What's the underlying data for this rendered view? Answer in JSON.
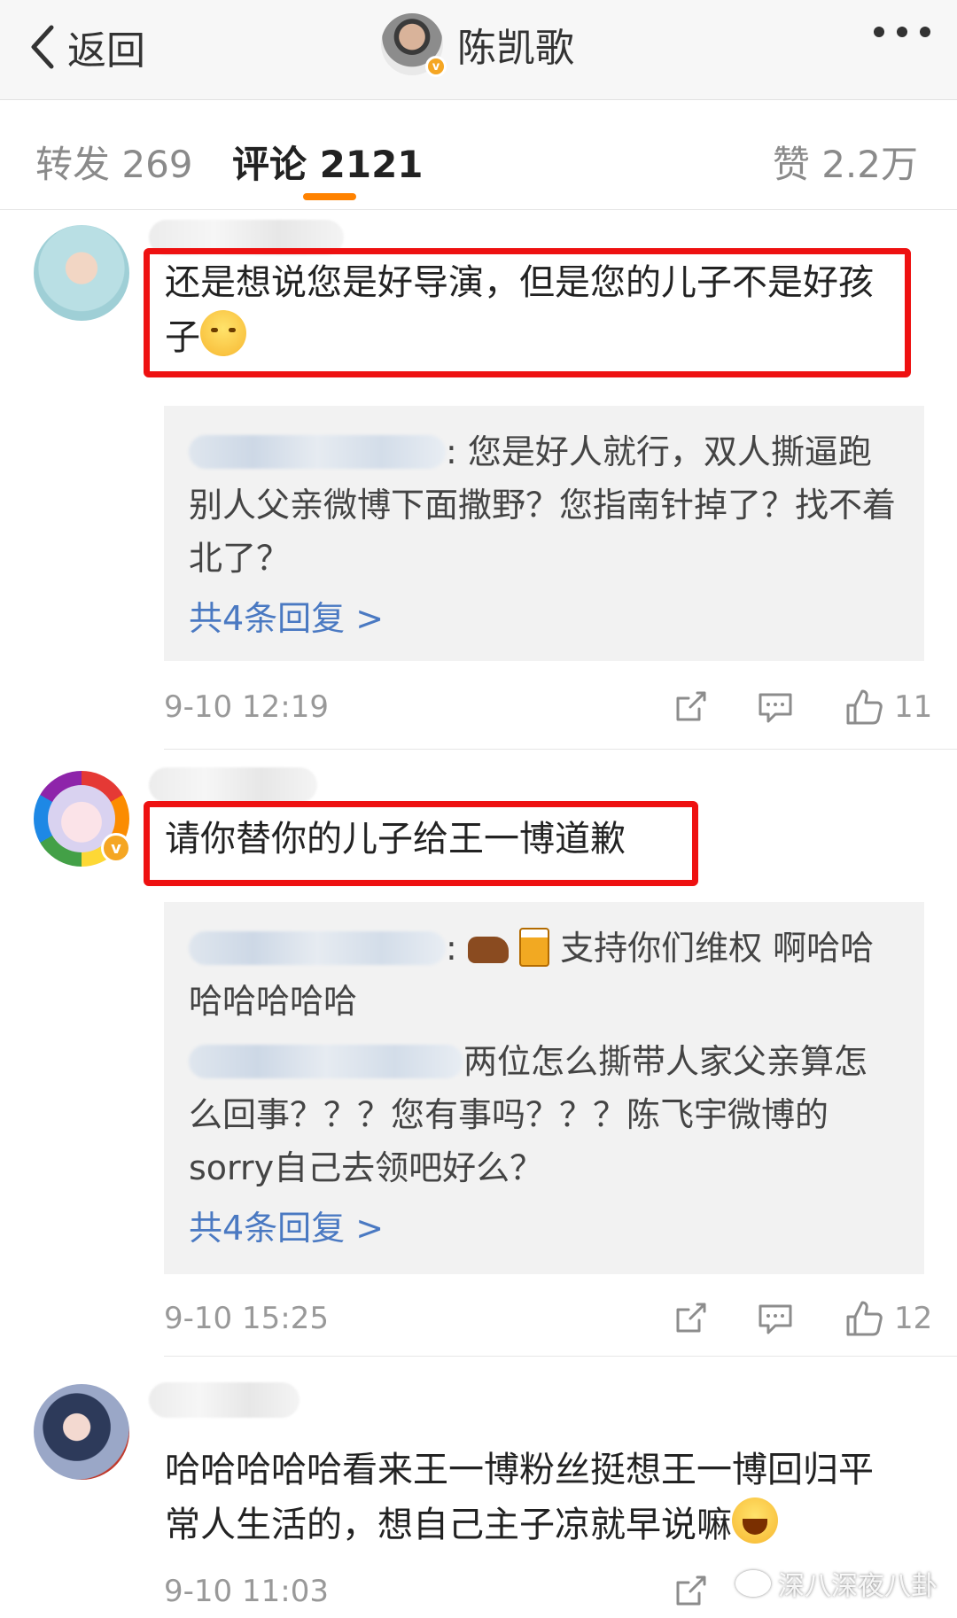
{
  "header": {
    "back_label": "返回",
    "title": "陈凯歌",
    "verified_mark": "v"
  },
  "tabs": {
    "repost": "转发 269",
    "comments": "评论 2121",
    "likes": "赞 2.2万"
  },
  "comments": [
    {
      "text": "还是想说您是好导演，但是您的儿子不是好孩子",
      "highlighted": true,
      "replies": [
        {
          "text": ": 您是好人就行，双人撕逼跑别人父亲微博下面撒野？您指南针掉了？找不着北了？"
        }
      ],
      "reply_more": "共4条回复 >",
      "time": "9-10 12:19",
      "likes": "11"
    },
    {
      "text": "请你替你的儿子给王一博道歉",
      "highlighted": true,
      "verified_mark": "v",
      "replies": [
        {
          "text": " 支持你们维权 啊哈哈哈哈哈哈哈"
        },
        {
          "text": "两位怎么撕带人家父亲算怎么回事？？？您有事吗？？？陈飞宇微博的sorry自己去领吧好么？"
        }
      ],
      "reply_more": "共4条回复 >",
      "time": "9-10 15:25",
      "likes": "12"
    },
    {
      "text": "哈哈哈哈哈看来王一博粉丝挺想王一博回归平常人生活的，想自己主子凉就早说嘛",
      "highlighted": false,
      "time": "9-10 11:03"
    }
  ],
  "watermark": "深八深夜八卦",
  "colors": {
    "accent": "#ff8200",
    "highlight_box": "#ee1111",
    "link": "#4a79c2"
  }
}
